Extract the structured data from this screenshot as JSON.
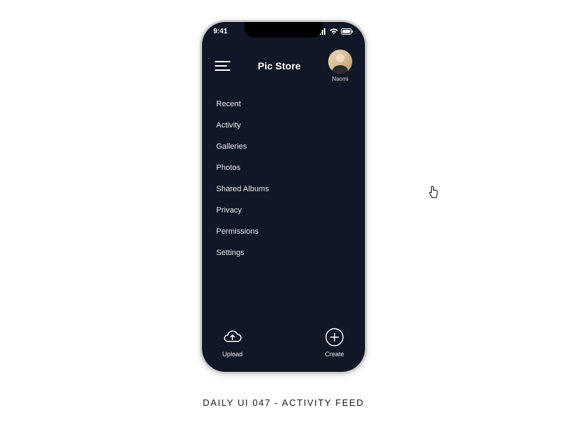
{
  "status": {
    "time": "9:41"
  },
  "header": {
    "title": "Pic Store",
    "profile_name": "Naomi"
  },
  "menu": {
    "items": [
      {
        "label": "Recent"
      },
      {
        "label": "Activity"
      },
      {
        "label": "Galleries"
      },
      {
        "label": "Photos"
      },
      {
        "label": "Shared Albums"
      },
      {
        "label": "Privacy"
      },
      {
        "label": "Permissions"
      },
      {
        "label": "Settings"
      }
    ]
  },
  "actions": {
    "upload": "Upload",
    "create": "Create"
  },
  "caption": "DAILY UI 047 - ACTIVITY FEED"
}
